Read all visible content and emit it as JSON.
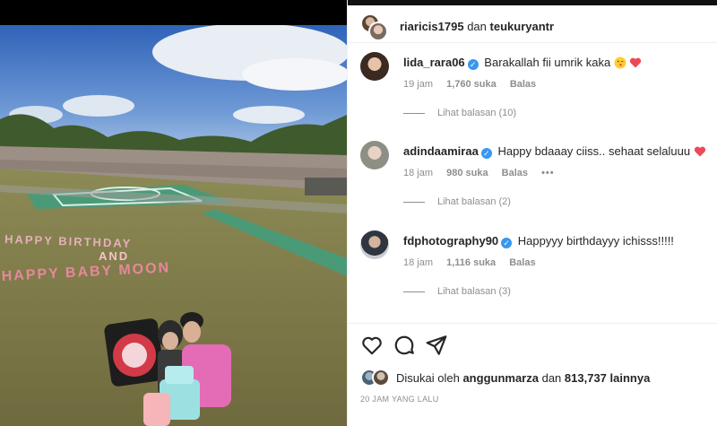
{
  "header": {
    "user1": "riaricis1795",
    "conjunction": "dan",
    "user2": "teukuryantr"
  },
  "photo": {
    "banner_line1": "HAPPY BIRTHDAY",
    "banner_line2": "AND",
    "banner_line3": "HAPPY BABY MOON"
  },
  "comments": [
    {
      "username": "lida_rara06",
      "verified": true,
      "text": "Barakallah fii umrik kaka",
      "time": "19 jam",
      "likes": "1,760 suka",
      "reply": "Balas",
      "view_replies": "Lihat balasan (10)"
    },
    {
      "username": "adindaamiraa",
      "verified": true,
      "text": "Happy bdaaay ciiss.. sehaat selaluuu",
      "time": "18 jam",
      "likes": "980 suka",
      "reply": "Balas",
      "more": "•••",
      "view_replies": "Lihat balasan (2)"
    },
    {
      "username": "fdphotography90",
      "verified": true,
      "text": "Happyyy birthdayyy ichisss!!!!!",
      "time": "18 jam",
      "likes": "1,116 suka",
      "reply": "Balas",
      "view_replies": "Lihat balasan (3)"
    }
  ],
  "actions": {
    "like_icon": "heart-icon",
    "comment_icon": "comment-icon",
    "share_icon": "share-icon"
  },
  "likes": {
    "prefix": "Disukai oleh",
    "user": "anggunmarza",
    "conjunction": "dan",
    "count": "813,737 lainnya"
  },
  "timestamp": "20 JAM YANG LALU",
  "colors": {
    "verified": "#3897f0",
    "heart": "#ed4956",
    "muted": "#8e8e8e"
  }
}
